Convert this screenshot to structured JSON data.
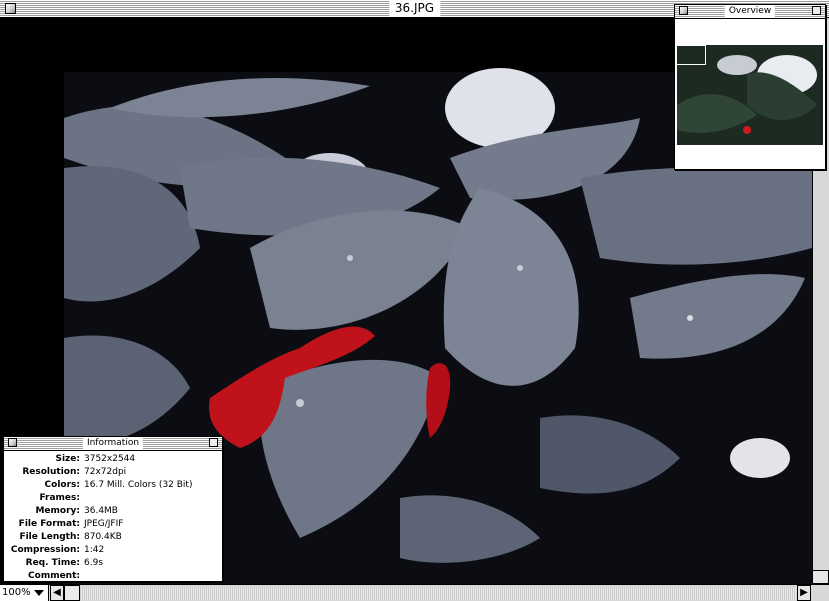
{
  "window": {
    "title": "36.JPG"
  },
  "overview": {
    "title": "Overview"
  },
  "information": {
    "title": "Information",
    "rows": [
      {
        "label": "Size",
        "value": "3752x2544"
      },
      {
        "label": "Resolution",
        "value": "72x72dpi"
      },
      {
        "label": "Colors",
        "value": "16.7 Mill. Colors (32 Bit)"
      },
      {
        "label": "Frames",
        "value": ""
      },
      {
        "label": "Memory",
        "value": "36.4MB"
      },
      {
        "label": "File Format",
        "value": "JPEG/JFIF"
      },
      {
        "label": "File Length",
        "value": "870.4KB"
      },
      {
        "label": "Compression",
        "value": "1:42"
      },
      {
        "label": "Req. Time",
        "value": "6.9s"
      },
      {
        "label": "Comment",
        "value": ""
      }
    ]
  },
  "statusbar": {
    "zoom": "100%"
  },
  "colors": {
    "leaf": "#4b5563",
    "berry": "#c0121a",
    "background": "#000000"
  }
}
